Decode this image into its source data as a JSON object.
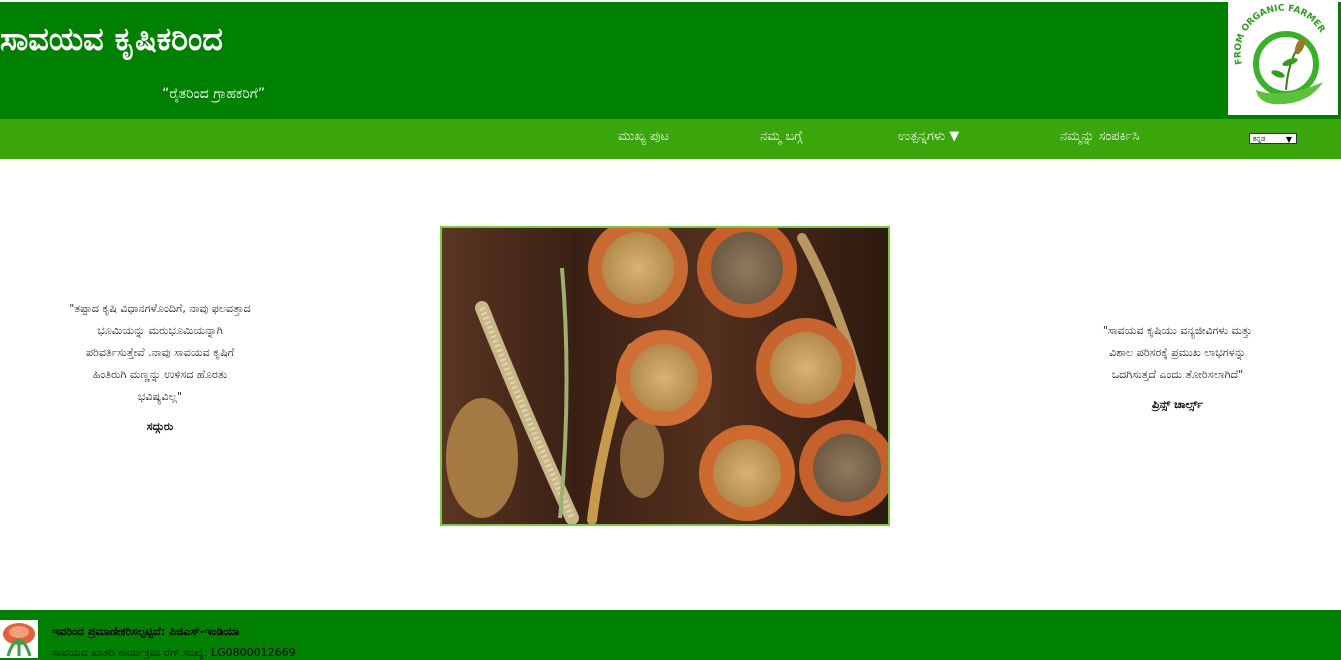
{
  "header": {
    "title": "ಸಾವಯವ ಕೃಷಿಕರಿಂದ",
    "tagline": "“ರೈತರಿಂದ ಗ್ರಾಹಕರಿಗೆ”",
    "logo_text": "FROM ORGANIC FARMER"
  },
  "nav": {
    "items": [
      {
        "label": "ಮುಖ್ಯ ಪುಟ"
      },
      {
        "label": "ನಮ್ಮ ಬಗ್ಗೆ"
      },
      {
        "label": "ಉತ್ಪನ್ನಗಳು ▼"
      },
      {
        "label": "ನಮ್ಮನ್ನು ಸಂಪರ್ಕಿಸಿ"
      }
    ],
    "language": {
      "selected": "ಕನ್ನಡ",
      "arrow": "▼"
    }
  },
  "quotes": {
    "left": {
      "lines": [
        "\"ತಪ್ಪಾದ ಕೃಷಿ ವಿಧಾನಗಳೊಂದಿಗೆ, ನಾವು ಫಲವತ್ತಾದ",
        "ಭೂಮಿಯನ್ನು ಮರುಭೂಮಿಯನ್ನಾಗಿ",
        "ಪರಿವರ್ತಿಸುತ್ತೇವೆ .ನಾವು ಸಾವಯವ ಕೃಷಿಗೆ",
        "ಹಿಂತಿರುಗಿ ಮಣ್ಣನ್ನು ಉಳಿಸದ ಹೊರತು",
        "ಭವಿಷ್ಯವಿಲ್ಲ\""
      ],
      "author": "ಸದ್ಗುರು"
    },
    "right": {
      "lines": [
        "\"ಸಾವಯವ ಕೃಷಿಯು ವನ್ಯಜೀವಿಗಳು ಮತ್ತು",
        "ವಿಶಾಲ ಪರಿಸರಕ್ಕೆ ಪ್ರಮುಖ ಲಾಭಗಳನ್ನು",
        "ಒದಗಿಸುತ್ತದೆ ಎಂದು ತೋರಿಸಲಾಗಿದೆ\""
      ],
      "author": "ಪ್ರಿನ್ಸ್ ಚಾರ್ಲ್ಸ್"
    }
  },
  "footer": {
    "certified": "ಇವರಿಂದ ಪ್ರಮಾಣೀಕರಿಸಲ್ಪಟ್ಟಿದೆ: ಪಿಜಿಎಸ್-ಇಂಡಿಯಾ",
    "registration": "ಸಾವಯವ ಖಾತರಿ ಕಾರ್ಯಕ್ರಮ ರೆಗ್ ಸಂಖ್ಯೆ: LG0800012669"
  },
  "colors": {
    "header_green": "#008000",
    "nav_green": "#3aa60c",
    "image_border": "#7ac943"
  }
}
